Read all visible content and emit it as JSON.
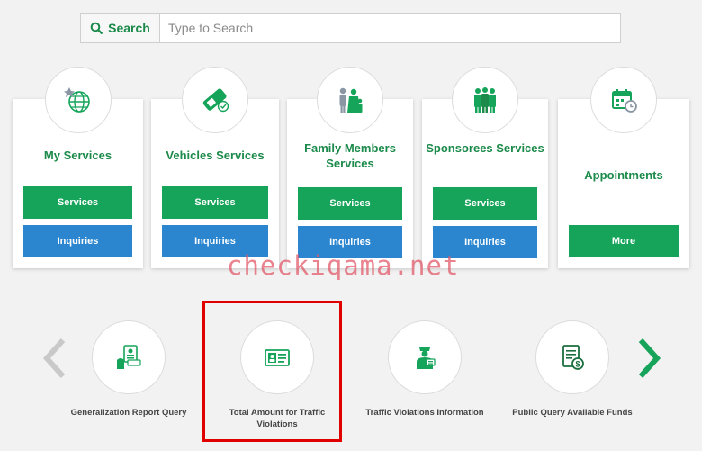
{
  "search": {
    "button_label": "Search",
    "placeholder": "Type to Search"
  },
  "cards": [
    {
      "title": "My Services",
      "btn1": "Services",
      "btn2": "Inquiries"
    },
    {
      "title": "Vehicles Services",
      "btn1": "Services",
      "btn2": "Inquiries"
    },
    {
      "title": "Family Members Services",
      "btn1": "Services",
      "btn2": "Inquiries"
    },
    {
      "title": "Sponsorees Services",
      "btn1": "Services",
      "btn2": "Inquiries"
    },
    {
      "title": "Appointments",
      "btn1": "More"
    }
  ],
  "watermark": "checkiqama.net",
  "quick_links": [
    {
      "label": "Generalization Report Query"
    },
    {
      "label": "Total Amount for Traffic Violations"
    },
    {
      "label": "Traffic Violations Information"
    },
    {
      "label": "Public Query Available Funds"
    }
  ],
  "colors": {
    "green": "#16a45a",
    "blue": "#2b86cf",
    "title_green": "#1b8a4a",
    "highlight": "#e00000"
  }
}
